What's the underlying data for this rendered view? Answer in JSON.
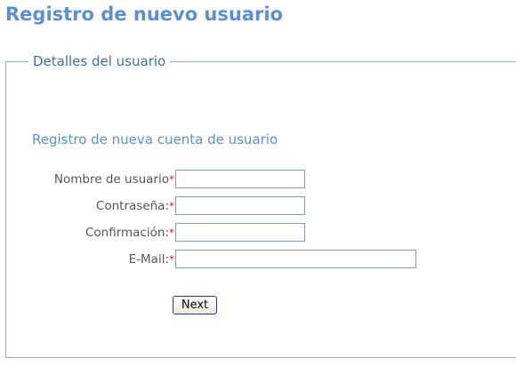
{
  "page": {
    "title": "Registro de nuevo usuario"
  },
  "fieldset": {
    "legend": "Detalles del usuario"
  },
  "form": {
    "section_title": "Registro de nueva cuenta de usuario",
    "required_marker": "*",
    "fields": {
      "username": {
        "label": "Nombre de usuario",
        "value": ""
      },
      "password": {
        "label": "Contraseña:",
        "value": ""
      },
      "confirm": {
        "label": "Confirmación:",
        "value": ""
      },
      "email": {
        "label": "E-Mail:",
        "value": ""
      }
    },
    "next_label": "Next"
  },
  "colors": {
    "title": "#5a8fd6",
    "legend": "#3f6fae",
    "required": "#cc1f1f",
    "border": "#8fb0d8"
  }
}
